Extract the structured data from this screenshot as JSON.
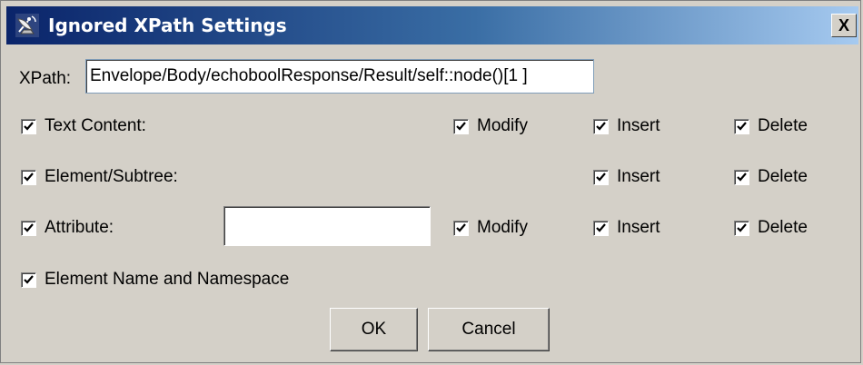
{
  "window": {
    "title": "Ignored XPath Settings",
    "close_label": "X"
  },
  "xpath": {
    "label": "XPath:",
    "value": "Envelope/Body/echoboolResponse/Result/self::node()[1 ]"
  },
  "rows": {
    "text_content": {
      "label": "Text Content:",
      "checked": true,
      "modify": "Modify",
      "insert": "Insert",
      "delete": "Delete"
    },
    "element_subtree": {
      "label": "Element/Subtree:",
      "checked": true,
      "insert": "Insert",
      "delete": "Delete"
    },
    "attribute": {
      "label": "Attribute:",
      "checked": true,
      "value": "",
      "modify": "Modify",
      "insert": "Insert",
      "delete": "Delete"
    },
    "element_name": {
      "label": "Element Name and Namespace",
      "checked": true
    }
  },
  "buttons": {
    "ok": "OK",
    "cancel": "Cancel"
  },
  "colors": {
    "title_start": "#0a246a",
    "title_end": "#a6caf0",
    "background": "#d4d0c8"
  }
}
